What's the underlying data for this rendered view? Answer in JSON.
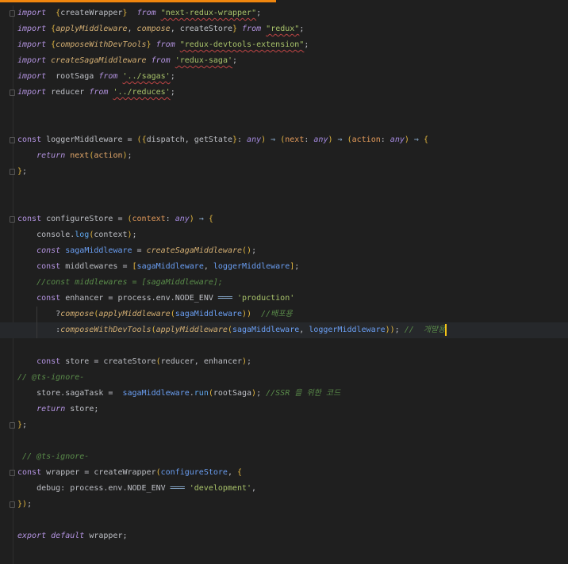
{
  "editor": {
    "accent_color": "#f0860e",
    "current_line": 20,
    "fold_lines": [
      0,
      5,
      8,
      10,
      13,
      26,
      29,
      31
    ],
    "lines": [
      [
        [
          "kwi",
          "import"
        ],
        [
          "",
          "  "
        ],
        [
          "br",
          "{"
        ],
        [
          "",
          "createWrapper"
        ],
        [
          "br",
          "}"
        ],
        [
          "",
          "  "
        ],
        [
          "kwi",
          "from"
        ],
        [
          "",
          " "
        ],
        [
          "str sq",
          "\"next-redux-wrapper\""
        ],
        [
          "",
          ";"
        ]
      ],
      [
        [
          "kwi",
          "import"
        ],
        [
          "",
          " "
        ],
        [
          "br",
          "{"
        ],
        [
          "fn",
          "applyMiddleware"
        ],
        [
          "",
          ", "
        ],
        [
          "fn",
          "compose"
        ],
        [
          "",
          ", createStore"
        ],
        [
          "br",
          "}"
        ],
        [
          "",
          " "
        ],
        [
          "kwi",
          "from"
        ],
        [
          "",
          " "
        ],
        [
          "str sq",
          "\"redux\""
        ],
        [
          "",
          ";"
        ]
      ],
      [
        [
          "kwi",
          "import"
        ],
        [
          "",
          " "
        ],
        [
          "br",
          "{"
        ],
        [
          "fn",
          "composeWithDevTools"
        ],
        [
          "br",
          "}"
        ],
        [
          "",
          " "
        ],
        [
          "kwi",
          "from"
        ],
        [
          "",
          " "
        ],
        [
          "str sq",
          "\"redux-devtools-extension\""
        ],
        [
          "",
          ";"
        ]
      ],
      [
        [
          "kwi",
          "import"
        ],
        [
          "",
          " "
        ],
        [
          "fn",
          "createSagaMiddleware"
        ],
        [
          "",
          " "
        ],
        [
          "kwi",
          "from"
        ],
        [
          "",
          " "
        ],
        [
          "str sq",
          "'redux-saga'"
        ],
        [
          "",
          ";"
        ]
      ],
      [
        [
          "kwi",
          "import"
        ],
        [
          "",
          "  rootSaga "
        ],
        [
          "kwi",
          "from"
        ],
        [
          "",
          " "
        ],
        [
          "str sq",
          "'../sagas'"
        ],
        [
          "",
          ";"
        ]
      ],
      [
        [
          "kwi",
          "import"
        ],
        [
          "",
          " reducer "
        ],
        [
          "kwi",
          "from"
        ],
        [
          "",
          " "
        ],
        [
          "str sq",
          "'../reduces'"
        ],
        [
          "",
          ";"
        ]
      ],
      [],
      [],
      [
        [
          "kw",
          "const"
        ],
        [
          "",
          " loggerMiddleware = "
        ],
        [
          "br",
          "("
        ],
        [
          "br",
          "{"
        ],
        [
          "",
          "dispatch, getState"
        ],
        [
          "br",
          "}"
        ],
        [
          "",
          ": "
        ],
        [
          "ty",
          "any"
        ],
        [
          "br",
          ")"
        ],
        [
          "",
          " "
        ],
        [
          "op",
          "⇒"
        ],
        [
          "",
          " "
        ],
        [
          "br",
          "("
        ],
        [
          "par",
          "next"
        ],
        [
          "",
          ": "
        ],
        [
          "ty",
          "any"
        ],
        [
          "br",
          ")"
        ],
        [
          "",
          " "
        ],
        [
          "op",
          "⇒"
        ],
        [
          "",
          " "
        ],
        [
          "br",
          "("
        ],
        [
          "par",
          "action"
        ],
        [
          "",
          ": "
        ],
        [
          "ty",
          "any"
        ],
        [
          "br",
          ")"
        ],
        [
          "",
          " "
        ],
        [
          "op",
          "⇒"
        ],
        [
          "",
          " "
        ],
        [
          "br",
          "{"
        ]
      ],
      [
        [
          "",
          "    "
        ],
        [
          "kwi",
          "return"
        ],
        [
          "",
          " "
        ],
        [
          "nx",
          "next"
        ],
        [
          "br",
          "("
        ],
        [
          "nx",
          "action"
        ],
        [
          "br",
          ")"
        ],
        [
          "",
          ";"
        ]
      ],
      [
        [
          "br",
          "}"
        ],
        [
          "",
          ";"
        ]
      ],
      [],
      [],
      [
        [
          "kw",
          "const"
        ],
        [
          "",
          " configureStore = "
        ],
        [
          "br",
          "("
        ],
        [
          "par",
          "context"
        ],
        [
          "",
          ": "
        ],
        [
          "ty",
          "any"
        ],
        [
          "br",
          ")"
        ],
        [
          "",
          " "
        ],
        [
          "op",
          "⇒"
        ],
        [
          "",
          " "
        ],
        [
          "br",
          "{"
        ]
      ],
      [
        [
          "",
          "    console."
        ],
        [
          "call",
          "log"
        ],
        [
          "br",
          "("
        ],
        [
          "",
          "context"
        ],
        [
          "br",
          ")"
        ],
        [
          "",
          ";"
        ]
      ],
      [
        [
          "",
          "    "
        ],
        [
          "kwi",
          "const"
        ],
        [
          "",
          " "
        ],
        [
          "var",
          "sagaMiddleware"
        ],
        [
          "",
          " = "
        ],
        [
          "fn",
          "createSagaMiddleware"
        ],
        [
          "br",
          "()"
        ],
        [
          "",
          ";"
        ]
      ],
      [
        [
          "",
          "    "
        ],
        [
          "kw",
          "const"
        ],
        [
          "",
          " middlewares = "
        ],
        [
          "br",
          "["
        ],
        [
          "var",
          "sagaMiddleware"
        ],
        [
          "",
          ", "
        ],
        [
          "var",
          "loggerMiddleware"
        ],
        [
          "br",
          "]"
        ],
        [
          "",
          ";"
        ]
      ],
      [
        [
          "cm",
          "    //const middlewares = [sagaMiddleware];"
        ]
      ],
      [
        [
          "",
          "    "
        ],
        [
          "kw",
          "const"
        ],
        [
          "",
          " enhancer = process.env.NODE_ENV "
        ],
        [
          "op",
          "═══"
        ],
        [
          "",
          " "
        ],
        [
          "str",
          "'production'"
        ]
      ],
      [
        [
          "",
          "        ?"
        ],
        [
          "fn",
          "compose"
        ],
        [
          "br",
          "("
        ],
        [
          "fn",
          "applyMiddleware"
        ],
        [
          "br",
          "("
        ],
        [
          "var",
          "sagaMiddleware"
        ],
        [
          "br",
          "))"
        ],
        [
          "",
          "  "
        ],
        [
          "cm",
          "//배포용"
        ]
      ],
      [
        [
          "",
          "        :"
        ],
        [
          "fn",
          "composeWithDevTools"
        ],
        [
          "br",
          "("
        ],
        [
          "fn",
          "applyMiddleware"
        ],
        [
          "br",
          "("
        ],
        [
          "var",
          "sagaMiddleware"
        ],
        [
          "",
          ", "
        ],
        [
          "var",
          "loggerMiddleware"
        ],
        [
          "br",
          "))"
        ],
        [
          "",
          "; "
        ],
        [
          "cm",
          "//  개발용"
        ]
      ],
      [],
      [
        [
          "",
          "    "
        ],
        [
          "kw",
          "const"
        ],
        [
          "",
          " store = createStore"
        ],
        [
          "br",
          "("
        ],
        [
          "",
          "reducer, enhancer"
        ],
        [
          "br",
          ")"
        ],
        [
          "",
          ";"
        ]
      ],
      [
        [
          "cm",
          "// @ts-ignore-"
        ]
      ],
      [
        [
          "",
          "    store.sagaTask =  "
        ],
        [
          "var",
          "sagaMiddleware"
        ],
        [
          "",
          "."
        ],
        [
          "call",
          "run"
        ],
        [
          "br",
          "("
        ],
        [
          "",
          "rootSaga"
        ],
        [
          "br",
          ")"
        ],
        [
          "",
          "; "
        ],
        [
          "cm",
          "//SSR 을 위한 코드"
        ]
      ],
      [
        [
          "",
          "    "
        ],
        [
          "kwi",
          "return"
        ],
        [
          "",
          " store;"
        ]
      ],
      [
        [
          "br",
          "}"
        ],
        [
          "",
          ";"
        ]
      ],
      [],
      [
        [
          "cm",
          " // @ts-ignore-"
        ]
      ],
      [
        [
          "kw",
          "const"
        ],
        [
          "",
          " wrapper = createWrapper"
        ],
        [
          "br",
          "("
        ],
        [
          "var",
          "configureStore"
        ],
        [
          "",
          ", "
        ],
        [
          "br",
          "{"
        ]
      ],
      [
        [
          "",
          "    debug: process.env.NODE_ENV "
        ],
        [
          "op",
          "═══"
        ],
        [
          "",
          " "
        ],
        [
          "str",
          "'development'"
        ],
        [
          "",
          ","
        ]
      ],
      [
        [
          "br",
          "}"
        ],
        [
          "br",
          ")"
        ],
        [
          "",
          ";"
        ]
      ],
      [],
      [
        [
          "kwi",
          "export"
        ],
        [
          "",
          " "
        ],
        [
          "kwi",
          "default"
        ],
        [
          "",
          " wrapper;"
        ]
      ]
    ]
  }
}
